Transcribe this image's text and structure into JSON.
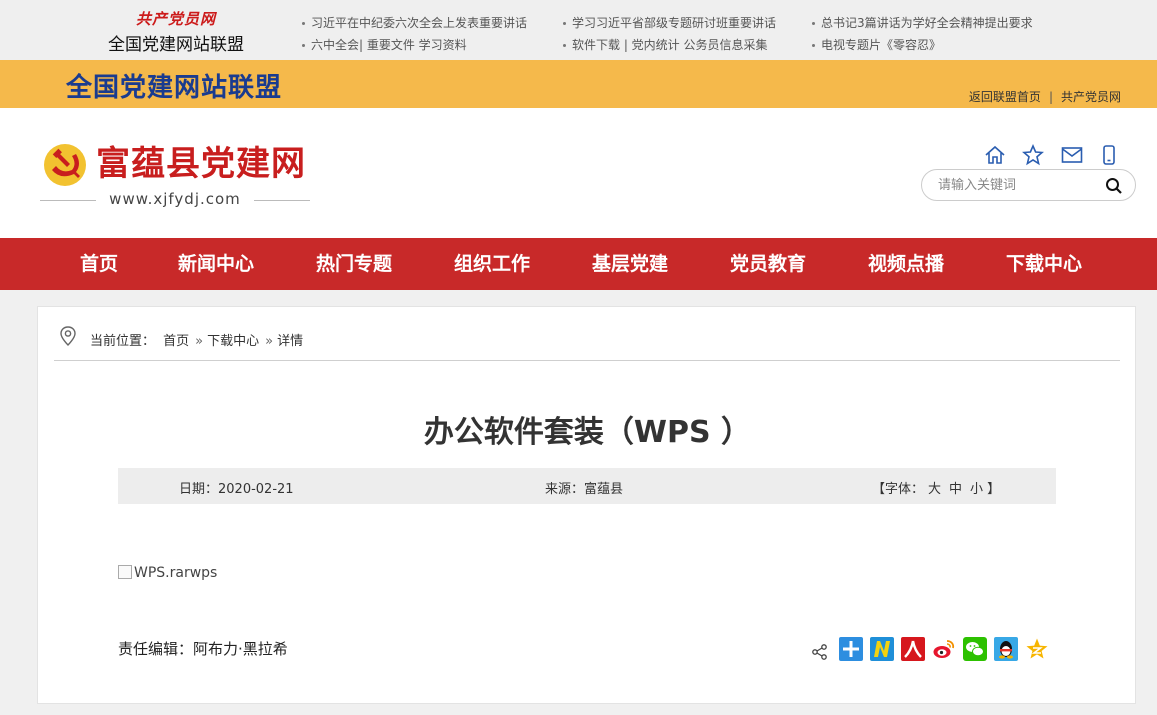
{
  "alliance": {
    "slogan": "共产党员网",
    "name": "全国党建网站联盟"
  },
  "toplinks": {
    "col1": [
      "习近平在中纪委六次全会上发表重要讲话",
      "六中全会| 重要文件 学习资料"
    ],
    "col2": [
      "学习习近平省部级专题研讨班重要讲话",
      "软件下载 | 党内统计 公务员信息采集"
    ],
    "col3": [
      "总书记3篇讲话为学好全会精神提出要求",
      "电视专题片《零容忍》"
    ]
  },
  "band": {
    "title": "全国党建网站联盟",
    "link_home": "返回联盟首页",
    "separator": "|",
    "link_member": "共产党员网"
  },
  "site": {
    "name": "富蕴县党建网",
    "url": "www.xjfydj.com"
  },
  "header_icons": [
    "home-icon",
    "star-icon",
    "mail-icon",
    "mobile-icon"
  ],
  "search": {
    "placeholder": "请输入关键词"
  },
  "nav": [
    "首页",
    "新闻中心",
    "热门专题",
    "组织工作",
    "基层党建",
    "党员教育",
    "视频点播",
    "下载中心"
  ],
  "breadcrumb": {
    "label": "当前位置：",
    "items": [
      "首页",
      "下载中心",
      "详情"
    ],
    "sep": "»"
  },
  "article": {
    "title": "办公软件套装（WPS ）",
    "date": "日期：2020-02-21",
    "source": "来源：富蕴县",
    "font_open": "【字体：",
    "font_large": "大",
    "font_medium": "中",
    "font_small": "小",
    "font_close": "】",
    "image_alt": "WPS.rarwps",
    "editor": "责任编辑：阿布力·黑拉希"
  },
  "share_icons": [
    "share-icon",
    "plus-share-icon",
    "netease-icon",
    "renren-icon",
    "weibo-icon",
    "wechat-icon",
    "qq-icon",
    "qzone-icon"
  ],
  "colors": {
    "nav_red": "#c82929",
    "band_yellow": "#f5b94b",
    "band_title": "#1a3b8f",
    "site_red": "#c81e1e"
  }
}
